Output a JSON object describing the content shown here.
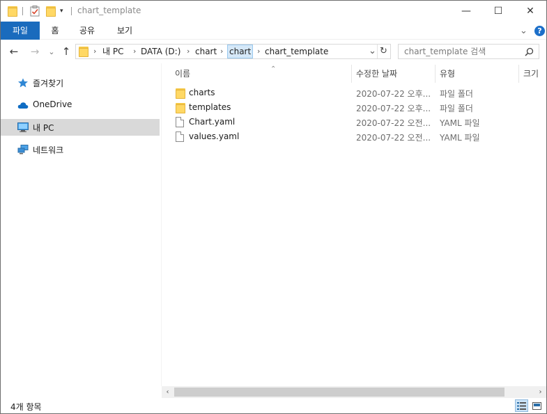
{
  "window": {
    "title": "chart_template",
    "minimize_glyph": "—",
    "maximize_glyph": "☐",
    "close_glyph": "✕"
  },
  "ribbon": {
    "tabs": [
      {
        "label": "파일"
      },
      {
        "label": "홈"
      },
      {
        "label": "공유"
      },
      {
        "label": "보기"
      }
    ],
    "expand_glyph": "⌄",
    "help_glyph": "?"
  },
  "nav": {
    "back_glyph": "←",
    "forward_glyph": "→",
    "recent_glyph": "⌄",
    "up_glyph": "↑",
    "breadcrumbs": [
      "내 PC",
      "DATA (D:)",
      "chart",
      "chart",
      "chart_template"
    ],
    "separator_glyph": "›",
    "dropdown_glyph": "⌄",
    "refresh_glyph": "↻"
  },
  "search": {
    "placeholder": "chart_template 검색"
  },
  "sidebar": {
    "items": [
      {
        "label": "즐겨찾기",
        "icon": "star-icon"
      },
      {
        "label": "OneDrive",
        "icon": "cloud-icon"
      },
      {
        "label": "내 PC",
        "icon": "computer-icon",
        "selected": true
      },
      {
        "label": "네트워크",
        "icon": "network-icon"
      }
    ]
  },
  "table": {
    "sort_glyph": "⌃",
    "columns": [
      "이름",
      "수정한 날짜",
      "유형",
      "크기"
    ],
    "rows": [
      {
        "name": "charts",
        "date": "2020-07-22 오후...",
        "type": "파일 폴더",
        "kind": "folder"
      },
      {
        "name": "templates",
        "date": "2020-07-22 오후...",
        "type": "파일 폴더",
        "kind": "folder"
      },
      {
        "name": "Chart.yaml",
        "date": "2020-07-22 오전...",
        "type": "YAML 파일",
        "kind": "file"
      },
      {
        "name": "values.yaml",
        "date": "2020-07-22 오전...",
        "type": "YAML 파일",
        "kind": "file"
      }
    ]
  },
  "scrollbar": {
    "left_glyph": "‹",
    "right_glyph": "›"
  },
  "status": {
    "item_count": "4개 항목"
  },
  "colors": {
    "accent": "#1a6bbd",
    "folder": "#ffd865",
    "selected": "#d9d9d9"
  }
}
